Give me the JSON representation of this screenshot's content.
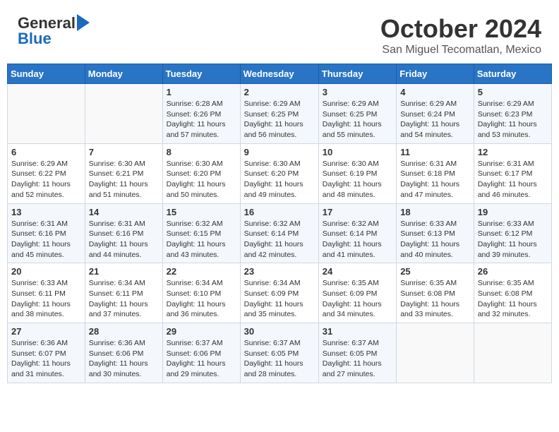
{
  "header": {
    "logo_line1": "General",
    "logo_line2": "Blue",
    "title": "October 2024",
    "subtitle": "San Miguel Tecomatlan, Mexico"
  },
  "days_of_week": [
    "Sunday",
    "Monday",
    "Tuesday",
    "Wednesday",
    "Thursday",
    "Friday",
    "Saturday"
  ],
  "weeks": [
    [
      {
        "day": "",
        "info": ""
      },
      {
        "day": "",
        "info": ""
      },
      {
        "day": "1",
        "info": "Sunrise: 6:28 AM\nSunset: 6:26 PM\nDaylight: 11 hours and 57 minutes."
      },
      {
        "day": "2",
        "info": "Sunrise: 6:29 AM\nSunset: 6:25 PM\nDaylight: 11 hours and 56 minutes."
      },
      {
        "day": "3",
        "info": "Sunrise: 6:29 AM\nSunset: 6:25 PM\nDaylight: 11 hours and 55 minutes."
      },
      {
        "day": "4",
        "info": "Sunrise: 6:29 AM\nSunset: 6:24 PM\nDaylight: 11 hours and 54 minutes."
      },
      {
        "day": "5",
        "info": "Sunrise: 6:29 AM\nSunset: 6:23 PM\nDaylight: 11 hours and 53 minutes."
      }
    ],
    [
      {
        "day": "6",
        "info": "Sunrise: 6:29 AM\nSunset: 6:22 PM\nDaylight: 11 hours and 52 minutes."
      },
      {
        "day": "7",
        "info": "Sunrise: 6:30 AM\nSunset: 6:21 PM\nDaylight: 11 hours and 51 minutes."
      },
      {
        "day": "8",
        "info": "Sunrise: 6:30 AM\nSunset: 6:20 PM\nDaylight: 11 hours and 50 minutes."
      },
      {
        "day": "9",
        "info": "Sunrise: 6:30 AM\nSunset: 6:20 PM\nDaylight: 11 hours and 49 minutes."
      },
      {
        "day": "10",
        "info": "Sunrise: 6:30 AM\nSunset: 6:19 PM\nDaylight: 11 hours and 48 minutes."
      },
      {
        "day": "11",
        "info": "Sunrise: 6:31 AM\nSunset: 6:18 PM\nDaylight: 11 hours and 47 minutes."
      },
      {
        "day": "12",
        "info": "Sunrise: 6:31 AM\nSunset: 6:17 PM\nDaylight: 11 hours and 46 minutes."
      }
    ],
    [
      {
        "day": "13",
        "info": "Sunrise: 6:31 AM\nSunset: 6:16 PM\nDaylight: 11 hours and 45 minutes."
      },
      {
        "day": "14",
        "info": "Sunrise: 6:31 AM\nSunset: 6:16 PM\nDaylight: 11 hours and 44 minutes."
      },
      {
        "day": "15",
        "info": "Sunrise: 6:32 AM\nSunset: 6:15 PM\nDaylight: 11 hours and 43 minutes."
      },
      {
        "day": "16",
        "info": "Sunrise: 6:32 AM\nSunset: 6:14 PM\nDaylight: 11 hours and 42 minutes."
      },
      {
        "day": "17",
        "info": "Sunrise: 6:32 AM\nSunset: 6:14 PM\nDaylight: 11 hours and 41 minutes."
      },
      {
        "day": "18",
        "info": "Sunrise: 6:33 AM\nSunset: 6:13 PM\nDaylight: 11 hours and 40 minutes."
      },
      {
        "day": "19",
        "info": "Sunrise: 6:33 AM\nSunset: 6:12 PM\nDaylight: 11 hours and 39 minutes."
      }
    ],
    [
      {
        "day": "20",
        "info": "Sunrise: 6:33 AM\nSunset: 6:11 PM\nDaylight: 11 hours and 38 minutes."
      },
      {
        "day": "21",
        "info": "Sunrise: 6:34 AM\nSunset: 6:11 PM\nDaylight: 11 hours and 37 minutes."
      },
      {
        "day": "22",
        "info": "Sunrise: 6:34 AM\nSunset: 6:10 PM\nDaylight: 11 hours and 36 minutes."
      },
      {
        "day": "23",
        "info": "Sunrise: 6:34 AM\nSunset: 6:09 PM\nDaylight: 11 hours and 35 minutes."
      },
      {
        "day": "24",
        "info": "Sunrise: 6:35 AM\nSunset: 6:09 PM\nDaylight: 11 hours and 34 minutes."
      },
      {
        "day": "25",
        "info": "Sunrise: 6:35 AM\nSunset: 6:08 PM\nDaylight: 11 hours and 33 minutes."
      },
      {
        "day": "26",
        "info": "Sunrise: 6:35 AM\nSunset: 6:08 PM\nDaylight: 11 hours and 32 minutes."
      }
    ],
    [
      {
        "day": "27",
        "info": "Sunrise: 6:36 AM\nSunset: 6:07 PM\nDaylight: 11 hours and 31 minutes."
      },
      {
        "day": "28",
        "info": "Sunrise: 6:36 AM\nSunset: 6:06 PM\nDaylight: 11 hours and 30 minutes."
      },
      {
        "day": "29",
        "info": "Sunrise: 6:37 AM\nSunset: 6:06 PM\nDaylight: 11 hours and 29 minutes."
      },
      {
        "day": "30",
        "info": "Sunrise: 6:37 AM\nSunset: 6:05 PM\nDaylight: 11 hours and 28 minutes."
      },
      {
        "day": "31",
        "info": "Sunrise: 6:37 AM\nSunset: 6:05 PM\nDaylight: 11 hours and 27 minutes."
      },
      {
        "day": "",
        "info": ""
      },
      {
        "day": "",
        "info": ""
      }
    ]
  ]
}
